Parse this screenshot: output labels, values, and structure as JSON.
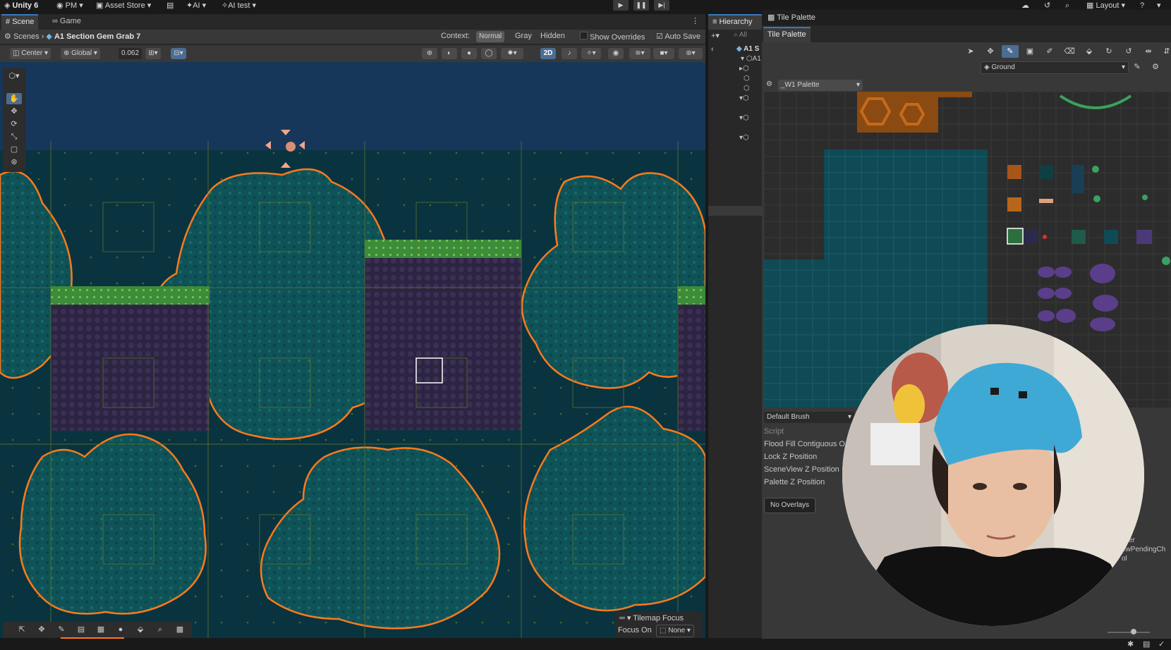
{
  "topbar": {
    "app": "Unity 6",
    "account": "PM",
    "asset_store": "Asset Store",
    "ai": "AI",
    "ai_test": "AI test",
    "layout": "Layout"
  },
  "scene": {
    "tabs": [
      "Scene",
      "Game"
    ],
    "breadcrumb_root": "Scenes",
    "breadcrumb_scene": "A1 Section Gem Grab 7",
    "context_label": "Context:",
    "context_options": [
      "Normal",
      "Gray",
      "Hidden"
    ],
    "show_overrides": "Show Overrides",
    "auto_save": "Auto Save",
    "pivot": "Center",
    "space": "Global",
    "snap_value": "0.062",
    "mode_2d": "2D",
    "tilemap_focus": "Tilemap Focus",
    "focus_on": "Focus On",
    "focus_value": "None"
  },
  "hierarchy": {
    "title": "Hierarchy",
    "search_placeholder": "All",
    "root_item": "A1 S",
    "child_item": "A1"
  },
  "palette": {
    "window_title": "Tile Palette",
    "tab": "Tile Palette",
    "active_tilemap": "Ground",
    "palette_name": "_W1 Palette",
    "brush": "Default Brush",
    "brush_props": [
      "Script",
      "Flood Fill Contiguous O",
      "Lock Z Position",
      "SceneView Z Position",
      "Palette Z Position"
    ],
    "overlays": "No Overlays",
    "inspector_tail": [
      "cker",
      "ewPendingCh",
      "ol"
    ]
  },
  "colors": {
    "accent_blue": "#3a79bb",
    "tile_outline": "#ff7a1a",
    "water": "#0a3340",
    "grass": "#4caf50",
    "rock": "#2f2440"
  },
  "icons": [
    "unity-logo-icon",
    "account-icon",
    "cart-icon",
    "sparkle-icon",
    "play-icon",
    "pause-icon",
    "step-icon",
    "cloud-icon",
    "history-icon",
    "search-icon",
    "help-icon",
    "scene-icon",
    "game-icon",
    "kebab-icon",
    "hierarchy-icon",
    "plus-icon",
    "gear-icon",
    "hand-tool-icon",
    "move-tool-icon",
    "rotate-tool-icon",
    "scale-tool-icon",
    "rect-tool-icon",
    "transform-tool-icon",
    "palette-icon",
    "brush-icon",
    "fill-icon",
    "eraser-icon",
    "picker-icon",
    "select-icon"
  ]
}
